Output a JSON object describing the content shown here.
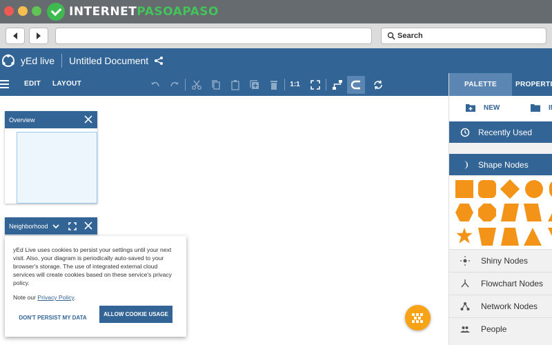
{
  "browser": {
    "brand_prefix": "INTERNET",
    "brand_suffix": "PASOAPASO",
    "nav_back_icon": "arrow-left-icon",
    "nav_forward_icon": "arrow-right-icon",
    "url_value": "",
    "search_placeholder": "Search"
  },
  "app": {
    "name": "yEd live",
    "document_title": "Untitled Document",
    "accent_color": "#326496",
    "toolbar": {
      "edit_label": "EDIT",
      "layout_label": "LAYOUT",
      "zoom_label": "1:1"
    }
  },
  "palette": {
    "tabs": [
      "PALETTE",
      "PROPERTIES"
    ],
    "new_label": "NEW",
    "import_label": "IM",
    "recently_used": "Recently Used",
    "shape_nodes": "Shape Nodes",
    "shape_color": "#f39418",
    "groups": [
      "Shiny Nodes",
      "Flowchart Nodes",
      "Network Nodes",
      "People"
    ]
  },
  "overview_panel": {
    "title": "Overview"
  },
  "neighborhood_panel": {
    "title": "Neighborhood"
  },
  "cookie_dialog": {
    "text": "yEd Live uses cookies to persist your settings until your next visit. Also, your diagram is periodically auto-saved to your browser's storage. The use of integrated external cloud services will create cookies based on these service's privacy policy.",
    "note_prefix": "Note our ",
    "privacy_link": "Privacy Policy",
    "note_suffix": ".",
    "dont_persist_label": "DON'T PERSIST MY DATA",
    "allow_label": "ALLOW COOKIE USAGE"
  }
}
